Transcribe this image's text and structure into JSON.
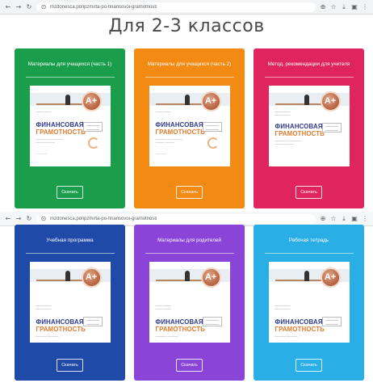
{
  "browser_top": {
    "url": "mzdonesca.pd/ipzmi/ta-po-finansovoi-gramotnosti",
    "url_host": "mzdonesca.pd",
    "icons": [
      "back-icon",
      "forward-icon",
      "reload-icon",
      "site-info-icon"
    ]
  },
  "page": {
    "title": "Для 2-3 классов"
  },
  "browser_second": {
    "url": "mzdonesca.pd/ipzmi/ta-po-finansovoi-gramotnosti",
    "url_host": "mzdonesca.pd"
  },
  "cover": {
    "line1": "ФИНАНСОВАЯ",
    "line2": "ГРАМОТНОСТЬ",
    "medal": "A+"
  },
  "cards": [
    {
      "title": "Материалы для учащихся (часть 1)",
      "button": "Скачать",
      "color": "#1a9e4c"
    },
    {
      "title": "Материалы для учащихся (часть 2)",
      "button": "Скачать",
      "color": "#f28a13"
    },
    {
      "title": "Метод. рекомендации для учителя",
      "button": "Скачать",
      "color": "#e0255e"
    },
    {
      "title": "Учебная программа",
      "button": "Скачать",
      "color": "#1f4aa8"
    },
    {
      "title": "Материалы для родителей",
      "button": "Скачать",
      "color": "#8a44d8"
    },
    {
      "title": "Рабочая тетрадь",
      "button": "Скачать",
      "color": "#2aaee6"
    }
  ]
}
